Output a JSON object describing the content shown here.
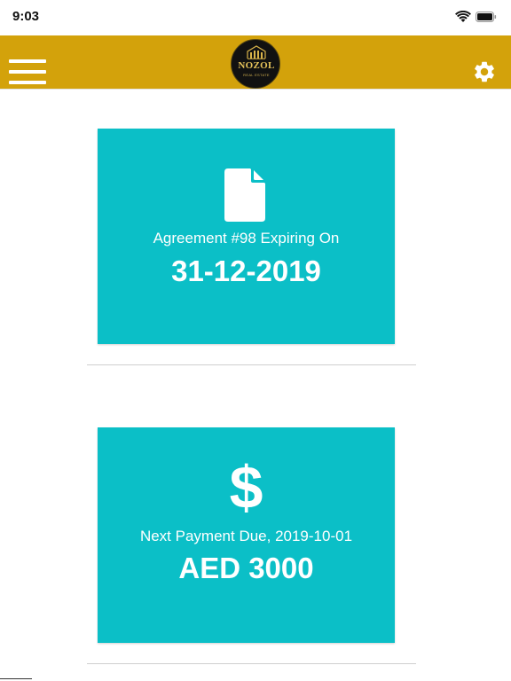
{
  "status_bar": {
    "time": "9:03",
    "wifi_icon": "wifi-icon",
    "battery_icon": "battery-icon"
  },
  "header": {
    "menu_icon": "hamburger-menu-icon",
    "logo": {
      "name": "NOZOL",
      "subtitle": "REAL ESTATE"
    },
    "settings_icon": "gear-icon",
    "background_color": "#d3a20b"
  },
  "cards": [
    {
      "icon": "document-icon",
      "caption": "Agreement #98 Expiring On",
      "value": "31-12-2019"
    },
    {
      "icon": "dollar-icon",
      "icon_glyph": "$",
      "caption": "Next Payment Due, 2019-10-01",
      "value": "AED 3000"
    }
  ],
  "colors": {
    "card_background": "#0bbfc7",
    "card_text": "#ffffff",
    "header_accent": "#d3a20b"
  }
}
